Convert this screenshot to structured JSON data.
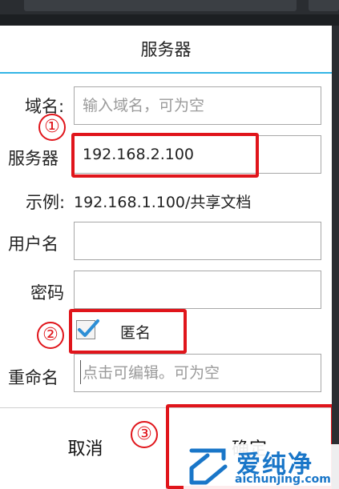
{
  "dialog": {
    "title": "服务器",
    "domain": {
      "label": "域名:",
      "placeholder": "输入域名，可为空",
      "value": ""
    },
    "server": {
      "label": "服务器",
      "value": "192.168.2.100"
    },
    "example": {
      "label": "示例:",
      "value": "192.168.1.100/共享文档"
    },
    "username": {
      "label": "用户名",
      "value": ""
    },
    "password": {
      "label": "密码",
      "value": ""
    },
    "anonymous": {
      "label": "匿名",
      "checked": true
    },
    "rename": {
      "label": "重命名",
      "placeholder": "点击可编辑。可为空",
      "value": ""
    },
    "buttons": {
      "cancel": "取消",
      "ok": "确定"
    }
  },
  "annotations": {
    "step1": "①",
    "step2": "②",
    "step3": "③"
  },
  "watermark": {
    "name": "爱纯净",
    "url": "aichunjing.com"
  },
  "colors": {
    "accent": "#33b5e5",
    "highlight": "#e0151b",
    "check": "#2d8fd6",
    "watermark": "#1976c8"
  }
}
